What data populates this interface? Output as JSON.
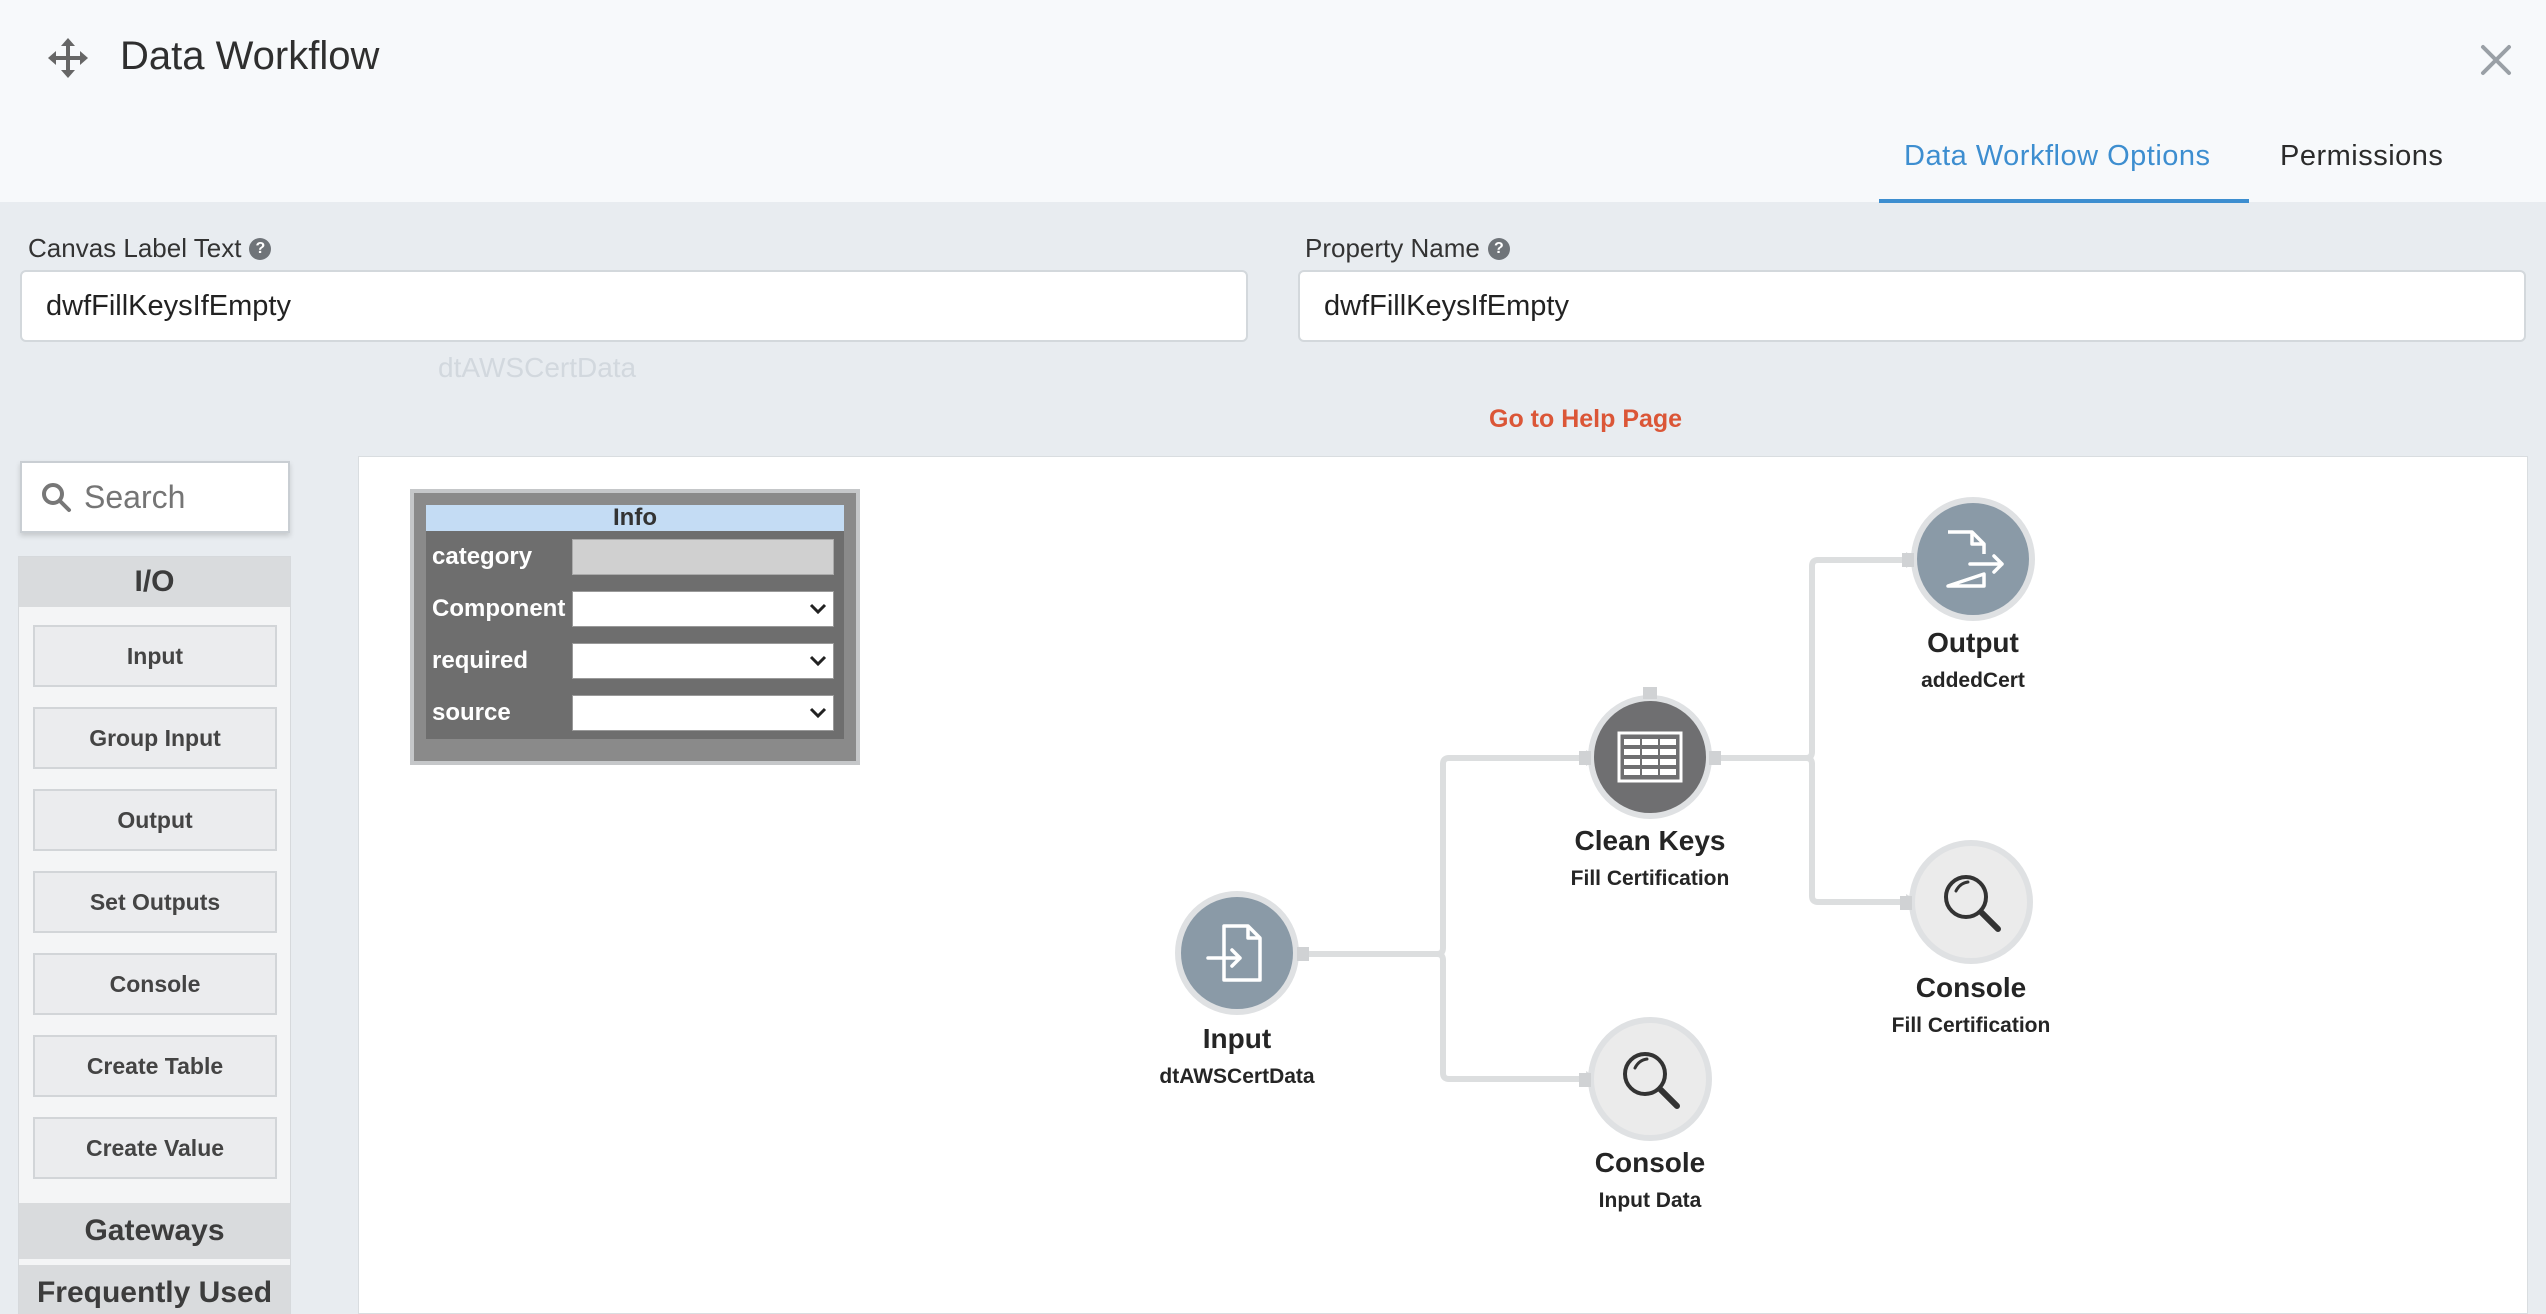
{
  "header": {
    "title": "Data Workflow",
    "tabs": [
      {
        "label": "Data Workflow Options",
        "active": true
      },
      {
        "label": "Permissions",
        "active": false
      }
    ]
  },
  "form": {
    "canvas_label": {
      "label": "Canvas Label Text",
      "value": "dwfFillKeysIfEmpty"
    },
    "property_name": {
      "label": "Property Name",
      "value": "dwfFillKeysIfEmpty"
    },
    "help_link": "Go to Help Page"
  },
  "palette": {
    "search_placeholder": "Search",
    "io_header": "I/O",
    "items": [
      "Input",
      "Group Input",
      "Output",
      "Set Outputs",
      "Console",
      "Create Table",
      "Create Value"
    ],
    "sections": [
      "Gateways",
      "Frequently Used"
    ]
  },
  "info_panel": {
    "title": "Info",
    "rows": [
      {
        "label": "category",
        "type": "static"
      },
      {
        "label": "Component",
        "type": "select"
      },
      {
        "label": "required",
        "type": "select"
      },
      {
        "label": "source",
        "type": "select"
      }
    ]
  },
  "nodes": {
    "input": {
      "label": "Input",
      "sub": "dtAWSCertData",
      "icon": "file-import-icon"
    },
    "clean_keys": {
      "label": "Clean Keys",
      "sub": "Fill Certification",
      "icon": "table-icon"
    },
    "output": {
      "label": "Output",
      "sub": "addedCert",
      "icon": "file-export-icon"
    },
    "console_fill": {
      "label": "Console",
      "sub": "Fill Certification",
      "icon": "magnifier-icon"
    },
    "console_input": {
      "label": "Console",
      "sub": "Input Data",
      "icon": "magnifier-icon"
    }
  },
  "colors": {
    "accent": "#3d8ed0",
    "help_link": "#db5637",
    "node_blue": "#8a9aa7",
    "node_dark": "#6f6f71"
  }
}
